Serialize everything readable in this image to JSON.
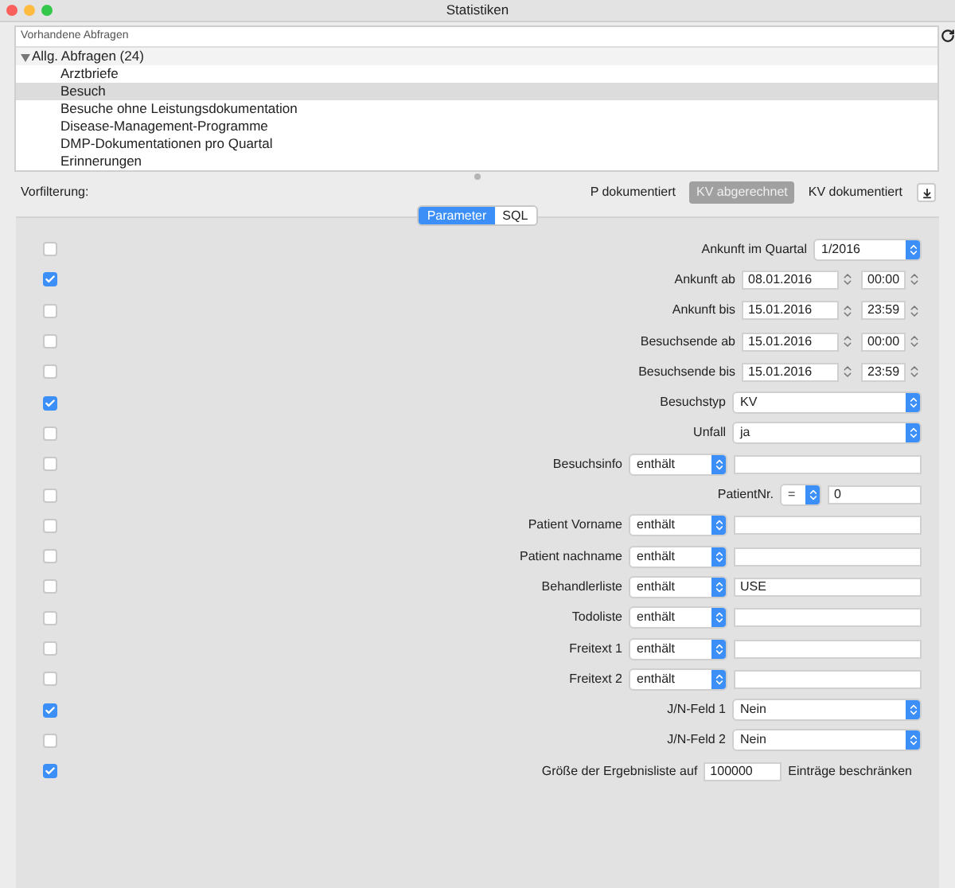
{
  "window": {
    "title": "Statistiken"
  },
  "queries": {
    "header": "Vorhandene Abfragen",
    "group": {
      "label": "Allg. Abfragen (24)",
      "expanded": true,
      "children": [
        {
          "label": "Arztbriefe",
          "selected": false
        },
        {
          "label": "Besuch",
          "selected": true
        },
        {
          "label": "Besuche ohne Leistungsdokumentation",
          "selected": false
        },
        {
          "label": "Disease-Management-Programme",
          "selected": false
        },
        {
          "label": "DMP-Dokumentationen pro Quartal",
          "selected": false
        },
        {
          "label": "Erinnerungen",
          "selected": false
        }
      ]
    }
  },
  "prefilter": {
    "label": "Vorfilterung:",
    "options": [
      {
        "label": "P dokumentiert",
        "selected": false
      },
      {
        "label": "KV abgerechnet",
        "selected": true
      },
      {
        "label": "KV dokumentiert",
        "selected": false
      }
    ]
  },
  "tabs": [
    {
      "label": "Parameter",
      "selected": true
    },
    {
      "label": "SQL",
      "selected": false
    }
  ],
  "rows": [
    {
      "kind": "quartal",
      "checked": false,
      "label": "Ankunft im Quartal",
      "value": "1/2016"
    },
    {
      "kind": "datetime",
      "checked": true,
      "label": "Ankunft ab",
      "value": "08.01.2016",
      "time": "00:00"
    },
    {
      "kind": "datetime",
      "checked": false,
      "label": "Ankunft bis",
      "value": "15.01.2016",
      "time": "23:59"
    },
    {
      "kind": "datetime",
      "checked": false,
      "label": "Besuchsende ab",
      "value": "15.01.2016",
      "time": "00:00"
    },
    {
      "kind": "datetime",
      "checked": false,
      "label": "Besuchsende bis",
      "value": "15.01.2016",
      "time": "23:59"
    },
    {
      "kind": "select",
      "checked": true,
      "label": "Besuchstyp",
      "value": "KV"
    },
    {
      "kind": "select",
      "checked": false,
      "label": "Unfall",
      "value": "ja"
    },
    {
      "kind": "text_filter",
      "checked": false,
      "label": "Besuchsinfo",
      "operator": "enthält"
    },
    {
      "kind": "number_filter",
      "checked": false,
      "label": "PatientNr.",
      "operator": "=",
      "value": "0"
    },
    {
      "kind": "text_filter",
      "checked": false,
      "label": "Patient Vorname",
      "operator": "enthält"
    },
    {
      "kind": "text_filter",
      "checked": false,
      "label": "Patient nachname",
      "operator": "enthält"
    },
    {
      "kind": "text_filter",
      "checked": false,
      "label": "Behandlerliste",
      "operator": "enthält",
      "value": "USE"
    },
    {
      "kind": "text_filter",
      "checked": false,
      "label": "Todoliste",
      "operator": "enthält"
    },
    {
      "kind": "text_filter",
      "checked": false,
      "label": "Freitext 1",
      "operator": "enthält"
    },
    {
      "kind": "text_filter",
      "checked": false,
      "label": "Freitext 2",
      "operator": "enthält"
    },
    {
      "kind": "select",
      "checked": true,
      "label": "J/N-Feld 1",
      "value": "Nein"
    },
    {
      "kind": "select",
      "checked": false,
      "label": "J/N-Feld 2",
      "value": "Nein"
    },
    {
      "kind": "limit",
      "checked": true,
      "label": "Größe der Ergebnisliste auf",
      "value": "100000",
      "suffix": "Einträge beschränken"
    }
  ]
}
